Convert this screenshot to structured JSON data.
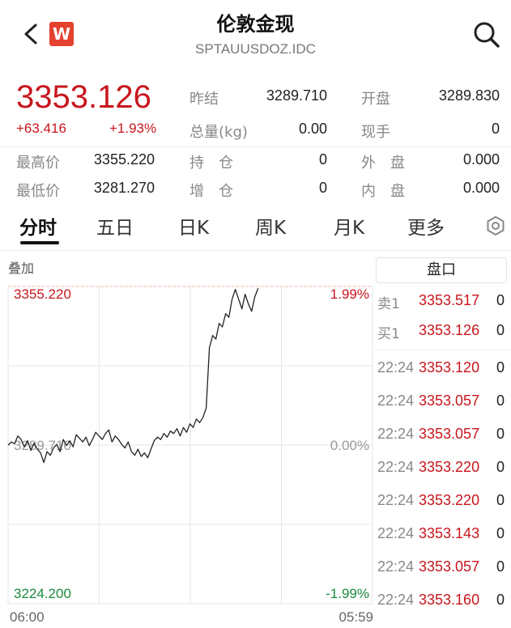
{
  "header": {
    "title": "伦敦金现",
    "subtitle": "SPTAUUSDOZ.IDC",
    "logo_text": "W",
    "logo_color": "#e4412f"
  },
  "quote": {
    "price": "3353.126",
    "change": "+63.416",
    "change_pct": "+1.93%",
    "up_color": "#c8161d",
    "fields": [
      {
        "label": "昨结",
        "value": "3289.710"
      },
      {
        "label": "开盘",
        "value": "3289.830"
      },
      {
        "label": "总量(kg)",
        "value": "0.00"
      },
      {
        "label": "现手",
        "value": "0"
      },
      {
        "label": "最高价",
        "value": "3355.220"
      },
      {
        "label": "持　仓",
        "value": "0"
      },
      {
        "label": "外　盘",
        "value": "0.000"
      },
      {
        "label": "最低价",
        "value": "3281.270"
      },
      {
        "label": "增　仓",
        "value": "0"
      },
      {
        "label": "内　盘",
        "value": "0.000"
      }
    ]
  },
  "tabs": [
    "分时",
    "五日",
    "日K",
    "周K",
    "月K",
    "更多"
  ],
  "overlay_label": "叠加",
  "panel": {
    "button": "盘口",
    "sell_label": "卖1",
    "sell_price": "3353.517",
    "sell_vol": "0",
    "buy_label": "买1",
    "buy_price": "3353.126",
    "buy_vol": "0",
    "ticks": [
      {
        "time": "22:24",
        "price": "3353.120",
        "vol": "0"
      },
      {
        "time": "22:24",
        "price": "3353.057",
        "vol": "0"
      },
      {
        "time": "22:24",
        "price": "3353.057",
        "vol": "0"
      },
      {
        "time": "22:24",
        "price": "3353.220",
        "vol": "0"
      },
      {
        "time": "22:24",
        "price": "3353.220",
        "vol": "0"
      },
      {
        "time": "22:24",
        "price": "3353.143",
        "vol": "0"
      },
      {
        "time": "22:24",
        "price": "3353.057",
        "vol": "0"
      },
      {
        "time": "22:24",
        "price": "3353.160",
        "vol": "0"
      }
    ]
  },
  "chart_data": {
    "type": "line",
    "y_top_label": "3355.220",
    "y_mid_label": "3289.710",
    "y_bottom_label": "3224.200",
    "pct_top_label": "1.99%",
    "pct_mid_label": "0.00%",
    "pct_bottom_label": "-1.99%",
    "x_start_label": "06:00",
    "x_end_label": "05:59",
    "ylim": [
      3224.2,
      3355.22
    ],
    "prev_close": 3289.71,
    "x_fraction_max": 1.0,
    "colors": {
      "up": "#c8161d",
      "down": "#1a8a3c",
      "line": "#222222",
      "grid": "#e6e6e6"
    },
    "series": [
      {
        "values": [
          3289.7,
          3291.0,
          3290.2,
          3293.5,
          3292.0,
          3289.0,
          3291.5,
          3287.5,
          3290.5,
          3288.0,
          3286.5,
          3282.5,
          3287.0,
          3285.5,
          3288.5,
          3290.0,
          3287.0,
          3292.0,
          3289.5,
          3291.5,
          3289.0,
          3294.0,
          3292.5,
          3291.0,
          3293.0,
          3289.5,
          3292.0,
          3295.0,
          3293.5,
          3292.0,
          3294.5,
          3296.0,
          3291.0,
          3293.5,
          3292.0,
          3290.0,
          3288.5,
          3291.0,
          3287.0,
          3285.5,
          3288.0,
          3285.0,
          3286.5,
          3284.5,
          3288.0,
          3291.5,
          3293.0,
          3292.0,
          3294.5,
          3293.0,
          3295.5,
          3294.5,
          3296.5,
          3293.5,
          3297.0,
          3295.0,
          3298.5,
          3297.0,
          3300.5,
          3299.0,
          3301.0,
          3305.0,
          3330.0,
          3335.0,
          3333.5,
          3340.0,
          3338.5,
          3344.0,
          3342.5,
          3350.0,
          3354.0,
          3350.0,
          3346.0,
          3352.0,
          3348.0,
          3345.0,
          3351.0,
          3354.5
        ]
      }
    ]
  }
}
